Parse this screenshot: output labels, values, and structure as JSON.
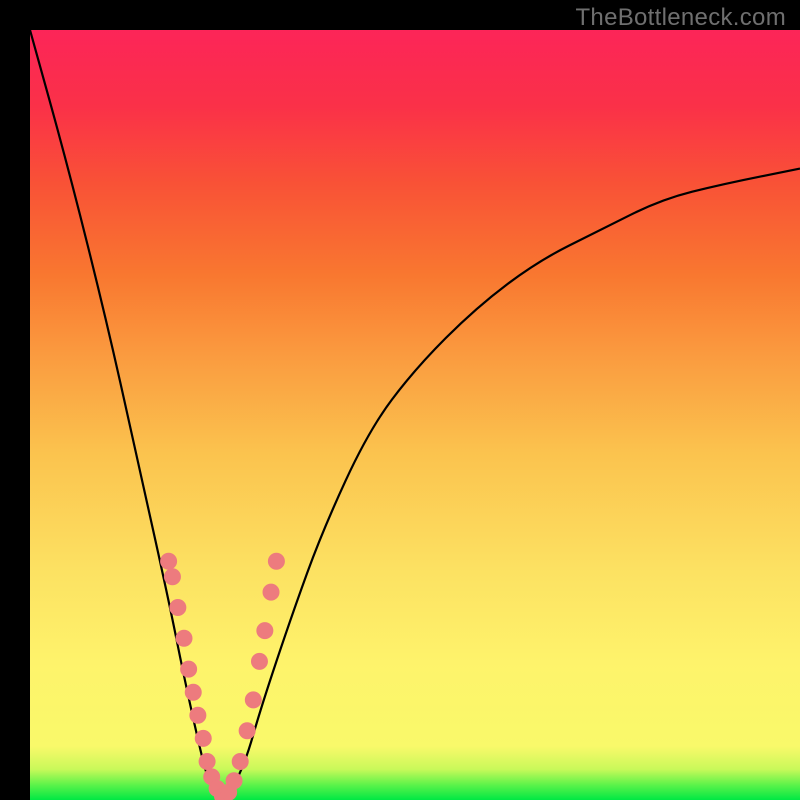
{
  "watermark": "TheBottleneck.com",
  "chart_data": {
    "type": "line",
    "title": "",
    "xlabel": "",
    "ylabel": "",
    "xlim": [
      0,
      100
    ],
    "ylim": [
      0,
      100
    ],
    "grid": false,
    "legend": false,
    "curve": {
      "description": "V-shaped bottleneck curve: penalty vs. relative hardware balance; minimum at ~25% x",
      "x": [
        0,
        5,
        10,
        14,
        18,
        20,
        22,
        23,
        24,
        25,
        26,
        28,
        30,
        34,
        38,
        44,
        50,
        58,
        66,
        74,
        82,
        90,
        100
      ],
      "y": [
        100,
        82,
        62,
        44,
        26,
        16,
        7,
        3,
        1,
        0,
        1,
        5,
        12,
        24,
        35,
        48,
        56,
        64,
        70,
        74,
        78,
        80,
        82
      ]
    },
    "markers": {
      "description": "Sample points clustered along both arms of the V near the bottom third",
      "points": [
        {
          "x": 18.0,
          "y": 31.0
        },
        {
          "x": 18.5,
          "y": 29.0
        },
        {
          "x": 19.2,
          "y": 25.0
        },
        {
          "x": 20.0,
          "y": 21.0
        },
        {
          "x": 20.6,
          "y": 17.0
        },
        {
          "x": 21.2,
          "y": 14.0
        },
        {
          "x": 21.8,
          "y": 11.0
        },
        {
          "x": 22.5,
          "y": 8.0
        },
        {
          "x": 23.0,
          "y": 5.0
        },
        {
          "x": 23.6,
          "y": 3.0
        },
        {
          "x": 24.3,
          "y": 1.5
        },
        {
          "x": 25.0,
          "y": 0.5
        },
        {
          "x": 25.8,
          "y": 1.0
        },
        {
          "x": 26.5,
          "y": 2.5
        },
        {
          "x": 27.3,
          "y": 5.0
        },
        {
          "x": 28.2,
          "y": 9.0
        },
        {
          "x": 29.0,
          "y": 13.0
        },
        {
          "x": 29.8,
          "y": 18.0
        },
        {
          "x": 30.5,
          "y": 22.0
        },
        {
          "x": 31.3,
          "y": 27.0
        },
        {
          "x": 32.0,
          "y": 31.0
        }
      ]
    },
    "gradient_stops": [
      {
        "pos": 0.0,
        "color": "#00e844"
      },
      {
        "pos": 0.04,
        "color": "#c9f95a"
      },
      {
        "pos": 0.18,
        "color": "#fef36b"
      },
      {
        "pos": 0.45,
        "color": "#fbc34e"
      },
      {
        "pos": 0.68,
        "color": "#f97830"
      },
      {
        "pos": 0.9,
        "color": "#fa3148"
      },
      {
        "pos": 1.0,
        "color": "#fc2558"
      }
    ]
  }
}
